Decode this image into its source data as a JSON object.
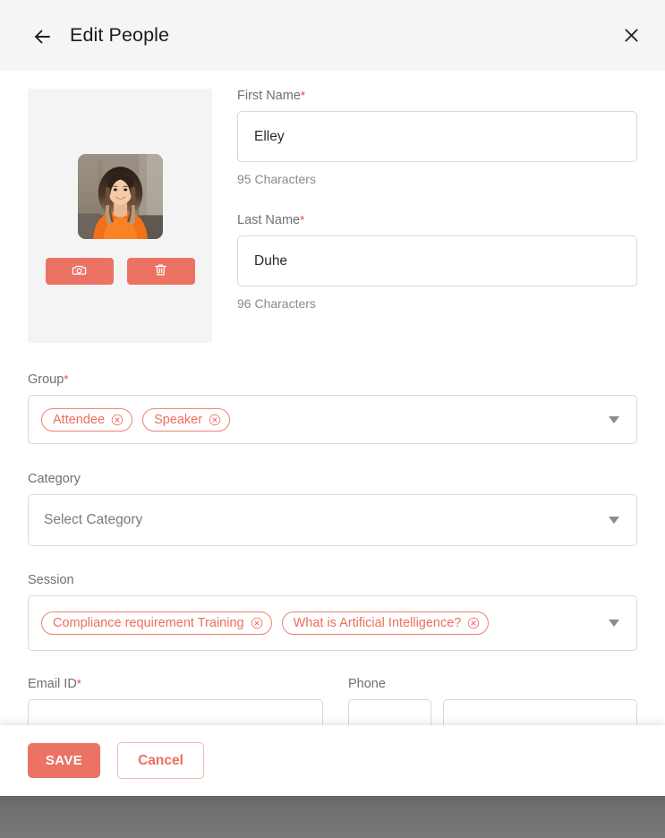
{
  "header": {
    "title": "Edit People",
    "back_icon": "arrow-left-icon",
    "close_icon": "close-icon"
  },
  "photo": {
    "camera_icon": "camera-icon",
    "delete_icon": "trash-icon",
    "alt": "person-portrait"
  },
  "fields": {
    "first_name": {
      "label": "First Name",
      "required": "*",
      "value": "Elley",
      "placeholder": "First Name",
      "helper": "95 Characters"
    },
    "last_name": {
      "label": "Last Name",
      "required": "*",
      "value": "Duhe",
      "placeholder": "Last Name",
      "helper": "96 Characters"
    },
    "group": {
      "label": "Group",
      "required": "*",
      "chips": [
        "Attendee",
        "Speaker"
      ],
      "caret_icon": "chevron-down-icon"
    },
    "category": {
      "label": "Category",
      "required": "",
      "placeholder": "Select Category",
      "caret_icon": "chevron-down-icon"
    },
    "session": {
      "label": "Session",
      "required": "",
      "chips": [
        "Compliance requirement Training",
        "What is Artificial Intelligence?"
      ],
      "caret_icon": "chevron-down-icon"
    },
    "email": {
      "label": "Email ID",
      "required": "*",
      "value": "",
      "placeholder": ""
    },
    "phone": {
      "label": "Phone",
      "required": "",
      "country_code": "",
      "number": ""
    }
  },
  "footer": {
    "save_label": "SAVE",
    "cancel_label": "Cancel"
  },
  "colors": {
    "accent": "#ec7363",
    "chip_border": "#ef8274",
    "chip_text": "#ef6e5c",
    "required_star": "#f03c2e",
    "header_bg": "#f5f5f5",
    "input_border": "#d8d8d8",
    "backdrop": "#6f6f6f"
  }
}
